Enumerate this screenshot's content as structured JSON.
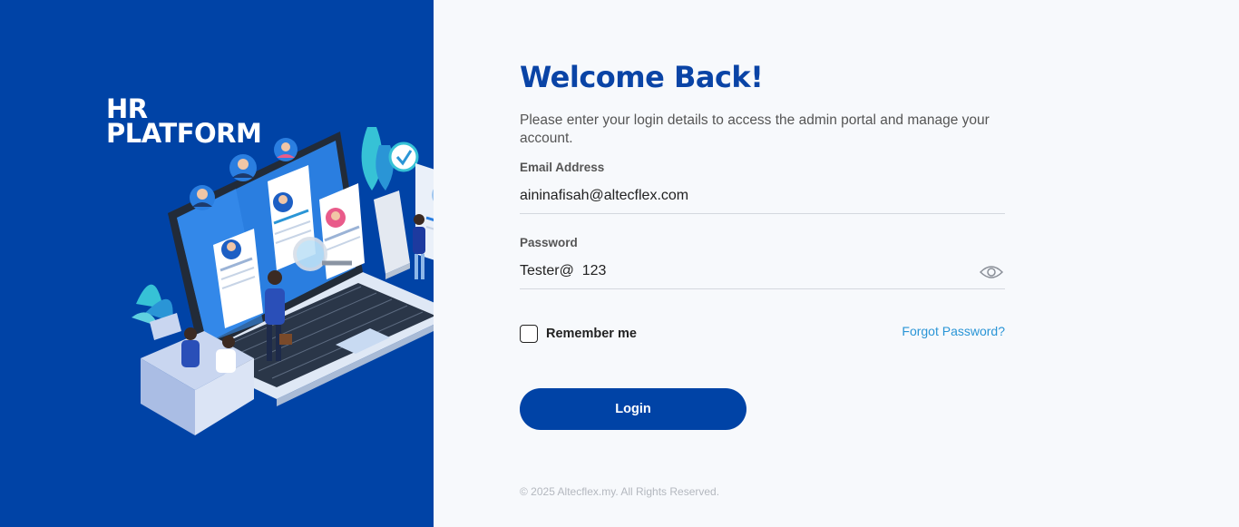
{
  "brand": {
    "line1": "HR",
    "line2": "PLATFORM"
  },
  "login": {
    "title": "Welcome Back!",
    "subtitle": "Please enter your login details to access the admin portal and manage your account.",
    "email_label": "Email Address",
    "email_value": "aininafisah@altecflex.com",
    "password_label": "Password",
    "password_value": "Tester@  123",
    "remember_label": "Remember me",
    "remember_checked": false,
    "forgot_label": "Forgot Password?",
    "login_button": "Login"
  },
  "footer": {
    "copyright": "© 2025 Altecflex.my. All Rights Reserved."
  },
  "colors": {
    "primary": "#0043a6",
    "link": "#2a95d6",
    "background": "#f7f9fc"
  },
  "icons": {
    "password_toggle": "eye-icon"
  }
}
